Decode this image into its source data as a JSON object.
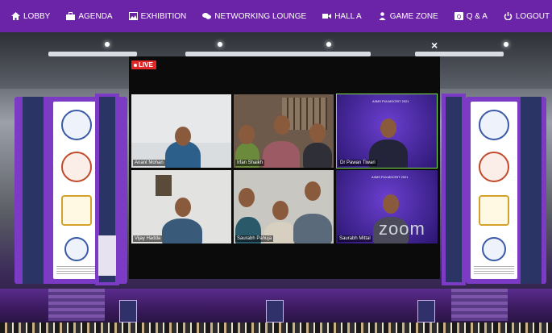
{
  "nav": {
    "items": [
      {
        "label": "LOBBY",
        "icon": "home-icon"
      },
      {
        "label": "AGENDA",
        "icon": "briefcase-icon"
      },
      {
        "label": "EXHIBITION",
        "icon": "image-icon"
      },
      {
        "label": "NETWORKING LOUNGE",
        "icon": "chat-icon"
      },
      {
        "label": "HALL A",
        "icon": "video-camera-icon"
      },
      {
        "label": "GAME ZONE",
        "icon": "person-icon"
      },
      {
        "label": "Q & A",
        "icon": "qa-icon"
      },
      {
        "label": "LOGOUT",
        "icon": "power-icon"
      }
    ]
  },
  "close_label": "×",
  "live_label": "LIVE",
  "meeting": {
    "brand": "zoom",
    "banner_text": "AIIMS PULMOCRIT 2021",
    "participants": [
      {
        "name": "Anant Mohan"
      },
      {
        "name": "Irfan Shaikh"
      },
      {
        "name": "Dr Pawan Tiwari"
      },
      {
        "name": "Vijay Hadda"
      },
      {
        "name": "Saurabh Pahuja"
      },
      {
        "name": "Saurabh Mittal"
      }
    ]
  },
  "colors": {
    "nav_bg": "#6b23a8",
    "accent": "#7b3bc4",
    "live": "#e02828",
    "active_speaker_border": "#7be04a"
  }
}
